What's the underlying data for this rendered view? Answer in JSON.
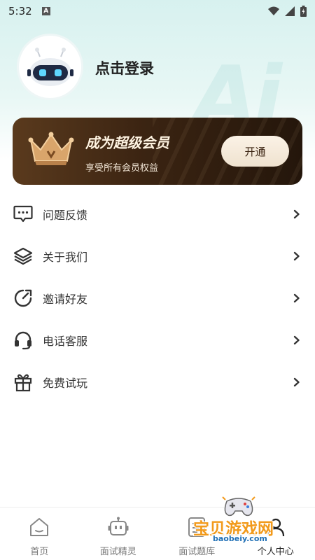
{
  "status_bar": {
    "time": "5:32",
    "notification_letter": "A"
  },
  "profile": {
    "login_label": "点击登录",
    "background_mark": "Ai"
  },
  "vip_card": {
    "title": "成为超级会员",
    "subtitle": "享受所有会员权益",
    "button_label": "开通"
  },
  "menu": {
    "items": [
      {
        "label": "问题反馈",
        "icon": "feedback-icon"
      },
      {
        "label": "关于我们",
        "icon": "layers-icon"
      },
      {
        "label": "邀请好友",
        "icon": "refresh-icon"
      },
      {
        "label": "电话客服",
        "icon": "headset-icon"
      },
      {
        "label": "免费试玩",
        "icon": "gift-icon"
      }
    ]
  },
  "tab_bar": {
    "tabs": [
      {
        "label": "首页",
        "icon": "home-icon"
      },
      {
        "label": "面试精灵",
        "icon": "robot-icon"
      },
      {
        "label": "面试题库",
        "icon": "question-bank-icon"
      },
      {
        "label": "个人中心",
        "icon": "user-icon",
        "active": true
      }
    ]
  },
  "watermark": {
    "title": "宝贝游戏网",
    "url": "baobeiy.com"
  },
  "colors": {
    "vip_dark": "#3b2412",
    "vip_button": "#f7ecdd",
    "top_gradient": "#d7f1ef",
    "watermark_orange": "#f29a1b"
  }
}
